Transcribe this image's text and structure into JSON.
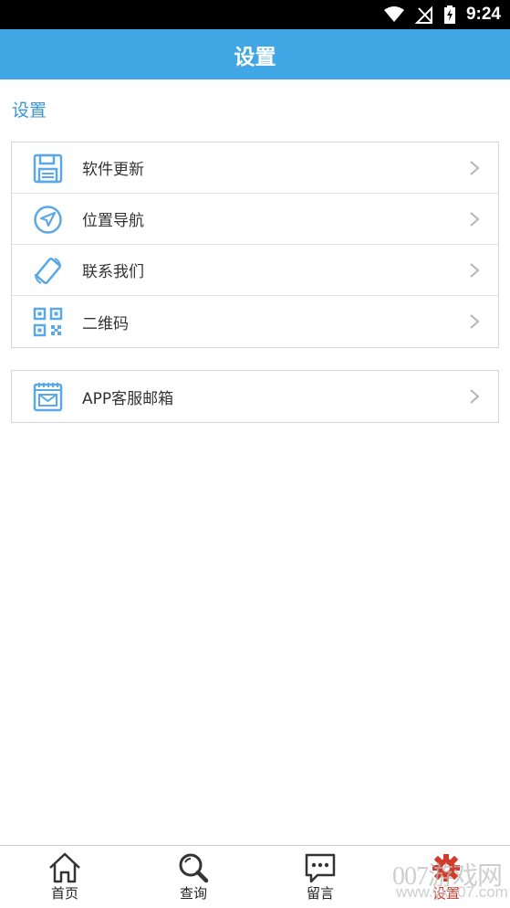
{
  "status_bar": {
    "time": "9:24",
    "icons": [
      "wifi-icon",
      "no-signal-icon",
      "battery-charging-icon"
    ]
  },
  "header": {
    "title": "设置"
  },
  "section": {
    "title": "设置"
  },
  "group_1": {
    "items": [
      {
        "label": "软件更新",
        "icon": "floppy-disk-icon"
      },
      {
        "label": "位置导航",
        "icon": "navigation-icon"
      },
      {
        "label": "联系我们",
        "icon": "phone-icon"
      },
      {
        "label": "二维码",
        "icon": "qr-code-icon"
      }
    ]
  },
  "group_2": {
    "items": [
      {
        "label": "APP客服邮箱",
        "icon": "mail-icon"
      }
    ]
  },
  "tab_bar": {
    "tabs": [
      {
        "label": "首页",
        "icon": "home-icon"
      },
      {
        "label": "查询",
        "icon": "search-icon"
      },
      {
        "label": "留言",
        "icon": "message-icon"
      },
      {
        "label": "设置",
        "icon": "settings-gear-icon",
        "active": true
      }
    ]
  },
  "watermark": {
    "text": "007游戏网",
    "url": "www.yx007.com"
  },
  "colors": {
    "primary": "#41a6e4",
    "active_tab": "#d23a2a",
    "icon": "#5aa9e6"
  }
}
